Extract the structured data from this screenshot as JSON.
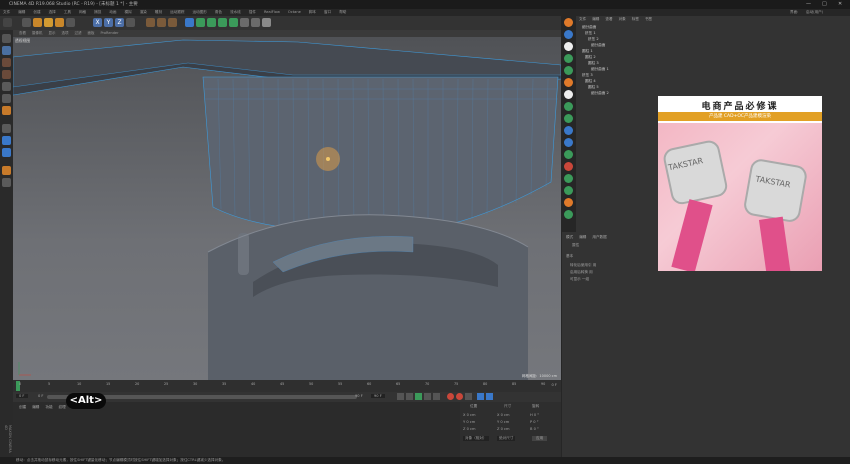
{
  "window": {
    "title": "CINEMA 4D R19.068 Studio (RC - R19) - [未标题 1 *] - 主要",
    "controls": [
      "—",
      "□",
      "✕"
    ]
  },
  "menu": [
    "文件",
    "编辑",
    "创建",
    "选择",
    "工具",
    "网格",
    "捕捉",
    "动画",
    "模拟",
    "渲染",
    "雕刻",
    "运动跟踪",
    "运动图形",
    "角色",
    "流水线",
    "插件",
    "RealFlow",
    "Octane",
    "脚本",
    "窗口",
    "帮助"
  ],
  "menu_right": [
    "界面:",
    "启动(用户)"
  ],
  "viewport": {
    "tabs": [
      "查看",
      "摄像机",
      "显示",
      "选项",
      "过滤",
      "面板",
      "ProRender"
    ],
    "label": "透视视图",
    "grid_info": "网格间距：10000 cm"
  },
  "timeline": {
    "ticks": [
      "0",
      "5",
      "10",
      "15",
      "20",
      "25",
      "30",
      "35",
      "40",
      "45",
      "50",
      "55",
      "60",
      "65",
      "70",
      "75",
      "80",
      "85",
      "90"
    ],
    "end_label": "0 F"
  },
  "transport": {
    "start": "0 F",
    "current": "0 F",
    "end": "90 F",
    "end2": "90 F"
  },
  "overlay_key": "<Alt>",
  "material_tabs": [
    "创建",
    "编辑",
    "功能",
    "纹理"
  ],
  "coords": {
    "headers": [
      "位置",
      "尺寸",
      "旋转"
    ],
    "rows": [
      [
        "X 0 cm",
        "X 0 cm",
        "H 0 °"
      ],
      [
        "Y 0 cm",
        "Y 0 cm",
        "P 0 °"
      ],
      [
        "Z 0 cm",
        "Z 0 cm",
        "B 0 °"
      ]
    ],
    "dropdown": "对象（相对）",
    "dropdown2": "绝对尺寸",
    "apply": "应用"
  },
  "object_panel": {
    "menu": [
      "文件",
      "编辑",
      "查看",
      "对象",
      "标签",
      "书签"
    ],
    "rows": [
      "细分曲面",
      "挤压 1",
      "挤压 2",
      "细分曲面",
      "圆柱 1",
      "圆柱 2",
      "圆柱 3",
      "细分曲面 1",
      "挤压 3",
      "圆柱 4",
      "圆柱 5",
      "细分曲面 2"
    ]
  },
  "attr_panel": {
    "tabs": [
      "模式",
      "编辑",
      "用户数据"
    ],
    "label": "属性",
    "section": "基本",
    "fields": [
      "转化后使用引 用",
      "启用后转换 用",
      "可显示 一组"
    ]
  },
  "promo": {
    "title": "电商产品必修课",
    "subtitle": "产品建 CAD+OC产品建模渲染",
    "brand": "TAKSTAR"
  },
  "status": "移动：点击并拖动鼠标移动元素，按住SHIFT键量化移动；节点编辑模式时按住SHIFT键增加选择对象；按住CTRL键减少选择对象。",
  "colors": {
    "accent": "#3a78c9",
    "orange": "#e2a025",
    "promo_pink": "#f3b7c4"
  }
}
